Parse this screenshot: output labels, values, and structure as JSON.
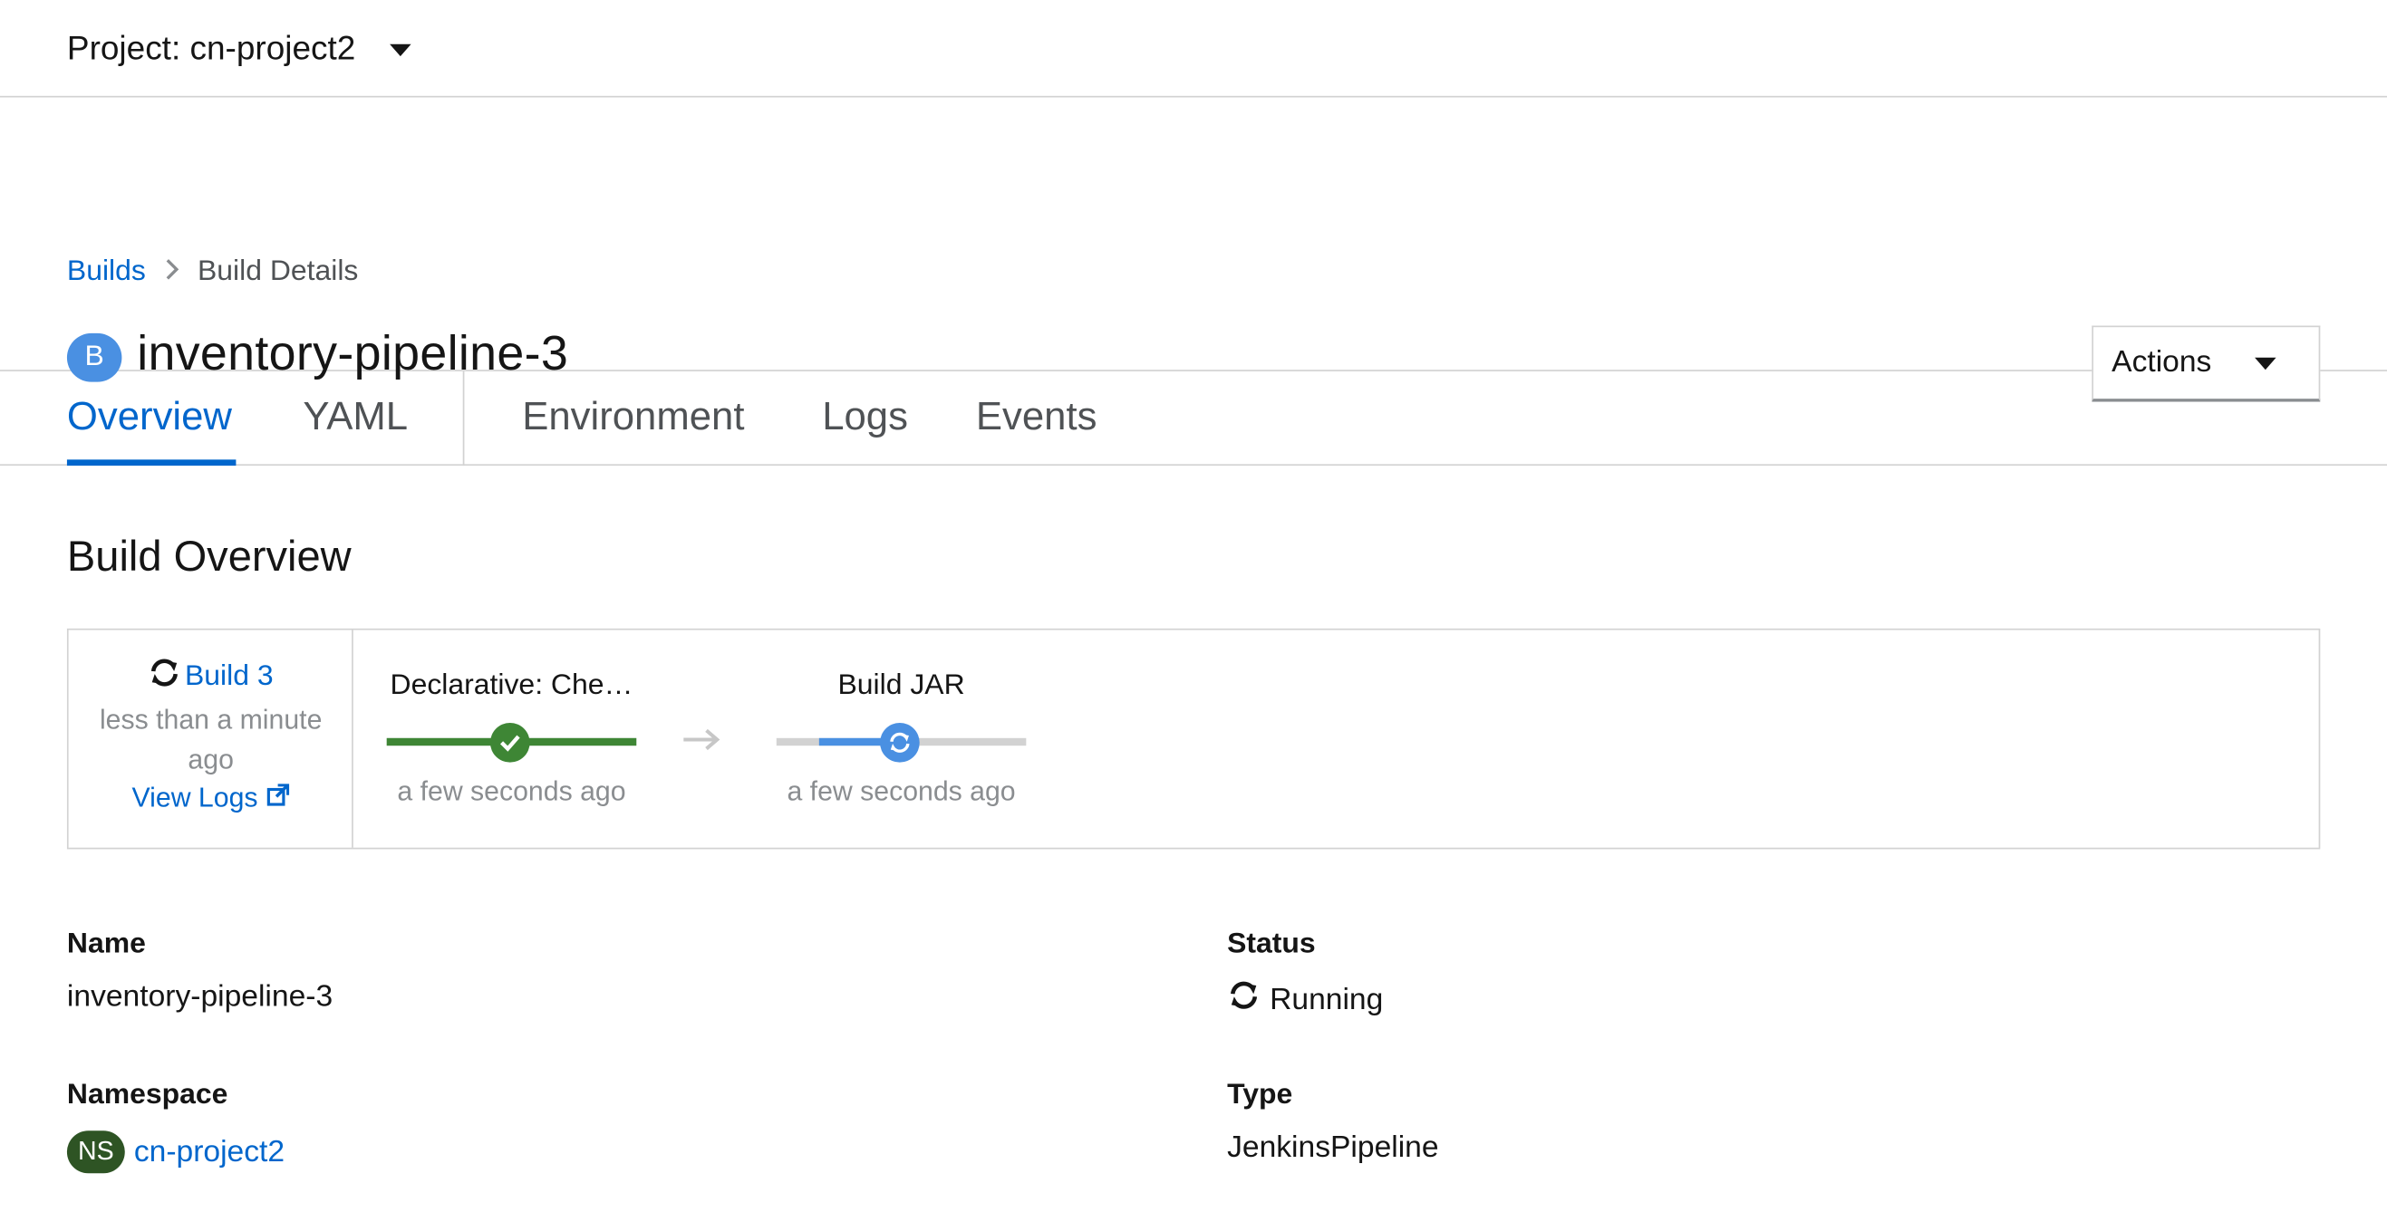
{
  "project_bar": {
    "label": "Project: cn-project2"
  },
  "breadcrumb": {
    "parent": "Builds",
    "current": "Build Details"
  },
  "header": {
    "badge": "B",
    "title": "inventory-pipeline-3",
    "actions_label": "Actions"
  },
  "tabs": [
    {
      "label": "Overview",
      "active": true
    },
    {
      "label": "YAML"
    },
    {
      "label": "Environment"
    },
    {
      "label": "Logs"
    },
    {
      "label": "Events"
    }
  ],
  "overview": {
    "section_title": "Build Overview",
    "build": {
      "label": "Build 3",
      "ago": "less than a minute ago",
      "view_logs": "View Logs"
    },
    "stages": [
      {
        "name": "Declarative: Che…",
        "time": "a few seconds ago",
        "status": "complete",
        "progress": 1.0,
        "color": "#3e8635"
      },
      {
        "name": "Build JAR",
        "time": "a few seconds ago",
        "status": "running",
        "progress": 0.5,
        "color": "#4a90e2"
      }
    ]
  },
  "details": {
    "name_label": "Name",
    "name_value": "inventory-pipeline-3",
    "namespace_label": "Namespace",
    "namespace_badge": "NS",
    "namespace_value": "cn-project2",
    "status_label": "Status",
    "status_value": "Running",
    "type_label": "Type",
    "type_value": "JenkinsPipeline"
  },
  "colors": {
    "link": "#0066cc",
    "accent": "#0066cc",
    "resource_badge": "#4a90e2",
    "namespace_badge": "#2e5424",
    "stage_complete": "#3e8635",
    "stage_running": "#4a90e2"
  }
}
